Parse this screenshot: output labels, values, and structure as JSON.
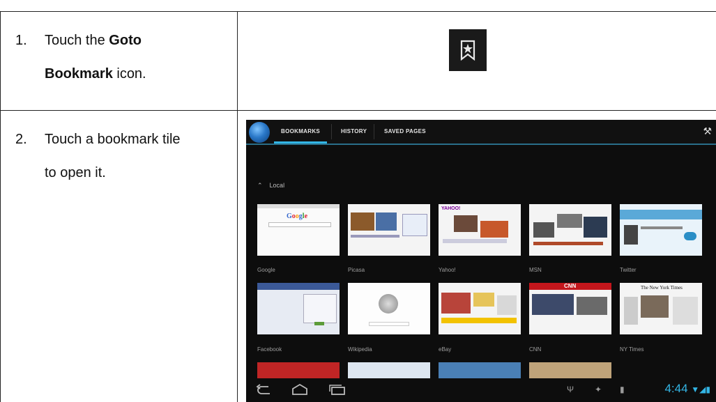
{
  "steps": [
    {
      "number": "1.",
      "line1_pre": "Touch the ",
      "line1_bold": "Goto",
      "line2_bold": "Bookmark",
      "line2_post": " icon."
    },
    {
      "number": "2.",
      "line1": "Touch a bookmark tile",
      "line2": "to open it."
    }
  ],
  "tablet": {
    "tabs": [
      "BOOKMARKS",
      "HISTORY",
      "SAVED PAGES"
    ],
    "section_label": "Local",
    "tiles": [
      {
        "label": "Google",
        "icon": "google-thumbnail"
      },
      {
        "label": "Picasa",
        "icon": "picasa-thumbnail"
      },
      {
        "label": "Yahoo!",
        "icon": "yahoo-thumbnail"
      },
      {
        "label": "MSN",
        "icon": "msn-thumbnail"
      },
      {
        "label": "Twitter",
        "icon": "twitter-thumbnail"
      },
      {
        "label": "Facebook",
        "icon": "facebook-thumbnail"
      },
      {
        "label": "Wikipedia",
        "icon": "wikipedia-thumbnail"
      },
      {
        "label": "eBay",
        "icon": "ebay-thumbnail"
      },
      {
        "label": "CNN",
        "icon": "cnn-thumbnail"
      },
      {
        "label": "NY Times",
        "icon": "nytimes-thumbnail"
      }
    ],
    "clock": "4:44",
    "colors": {
      "accent": "#33b5e5",
      "background": "#0d0d0d"
    }
  }
}
